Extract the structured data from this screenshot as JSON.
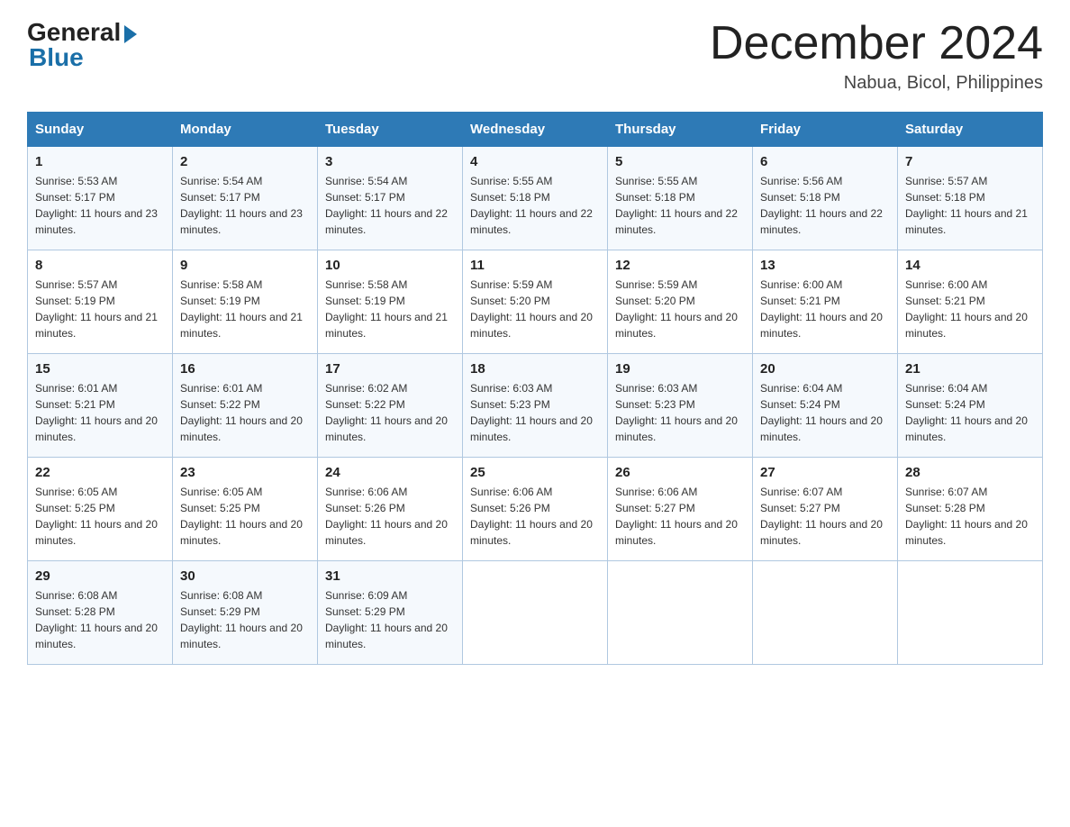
{
  "logo": {
    "general": "General",
    "blue": "Blue"
  },
  "header": {
    "month": "December 2024",
    "location": "Nabua, Bicol, Philippines"
  },
  "days_of_week": [
    "Sunday",
    "Monday",
    "Tuesday",
    "Wednesday",
    "Thursday",
    "Friday",
    "Saturday"
  ],
  "weeks": [
    [
      {
        "day": "1",
        "sunrise": "5:53 AM",
        "sunset": "5:17 PM",
        "daylight": "11 hours and 23 minutes."
      },
      {
        "day": "2",
        "sunrise": "5:54 AM",
        "sunset": "5:17 PM",
        "daylight": "11 hours and 23 minutes."
      },
      {
        "day": "3",
        "sunrise": "5:54 AM",
        "sunset": "5:17 PM",
        "daylight": "11 hours and 22 minutes."
      },
      {
        "day": "4",
        "sunrise": "5:55 AM",
        "sunset": "5:18 PM",
        "daylight": "11 hours and 22 minutes."
      },
      {
        "day": "5",
        "sunrise": "5:55 AM",
        "sunset": "5:18 PM",
        "daylight": "11 hours and 22 minutes."
      },
      {
        "day": "6",
        "sunrise": "5:56 AM",
        "sunset": "5:18 PM",
        "daylight": "11 hours and 22 minutes."
      },
      {
        "day": "7",
        "sunrise": "5:57 AM",
        "sunset": "5:18 PM",
        "daylight": "11 hours and 21 minutes."
      }
    ],
    [
      {
        "day": "8",
        "sunrise": "5:57 AM",
        "sunset": "5:19 PM",
        "daylight": "11 hours and 21 minutes."
      },
      {
        "day": "9",
        "sunrise": "5:58 AM",
        "sunset": "5:19 PM",
        "daylight": "11 hours and 21 minutes."
      },
      {
        "day": "10",
        "sunrise": "5:58 AM",
        "sunset": "5:19 PM",
        "daylight": "11 hours and 21 minutes."
      },
      {
        "day": "11",
        "sunrise": "5:59 AM",
        "sunset": "5:20 PM",
        "daylight": "11 hours and 20 minutes."
      },
      {
        "day": "12",
        "sunrise": "5:59 AM",
        "sunset": "5:20 PM",
        "daylight": "11 hours and 20 minutes."
      },
      {
        "day": "13",
        "sunrise": "6:00 AM",
        "sunset": "5:21 PM",
        "daylight": "11 hours and 20 minutes."
      },
      {
        "day": "14",
        "sunrise": "6:00 AM",
        "sunset": "5:21 PM",
        "daylight": "11 hours and 20 minutes."
      }
    ],
    [
      {
        "day": "15",
        "sunrise": "6:01 AM",
        "sunset": "5:21 PM",
        "daylight": "11 hours and 20 minutes."
      },
      {
        "day": "16",
        "sunrise": "6:01 AM",
        "sunset": "5:22 PM",
        "daylight": "11 hours and 20 minutes."
      },
      {
        "day": "17",
        "sunrise": "6:02 AM",
        "sunset": "5:22 PM",
        "daylight": "11 hours and 20 minutes."
      },
      {
        "day": "18",
        "sunrise": "6:03 AM",
        "sunset": "5:23 PM",
        "daylight": "11 hours and 20 minutes."
      },
      {
        "day": "19",
        "sunrise": "6:03 AM",
        "sunset": "5:23 PM",
        "daylight": "11 hours and 20 minutes."
      },
      {
        "day": "20",
        "sunrise": "6:04 AM",
        "sunset": "5:24 PM",
        "daylight": "11 hours and 20 minutes."
      },
      {
        "day": "21",
        "sunrise": "6:04 AM",
        "sunset": "5:24 PM",
        "daylight": "11 hours and 20 minutes."
      }
    ],
    [
      {
        "day": "22",
        "sunrise": "6:05 AM",
        "sunset": "5:25 PM",
        "daylight": "11 hours and 20 minutes."
      },
      {
        "day": "23",
        "sunrise": "6:05 AM",
        "sunset": "5:25 PM",
        "daylight": "11 hours and 20 minutes."
      },
      {
        "day": "24",
        "sunrise": "6:06 AM",
        "sunset": "5:26 PM",
        "daylight": "11 hours and 20 minutes."
      },
      {
        "day": "25",
        "sunrise": "6:06 AM",
        "sunset": "5:26 PM",
        "daylight": "11 hours and 20 minutes."
      },
      {
        "day": "26",
        "sunrise": "6:06 AM",
        "sunset": "5:27 PM",
        "daylight": "11 hours and 20 minutes."
      },
      {
        "day": "27",
        "sunrise": "6:07 AM",
        "sunset": "5:27 PM",
        "daylight": "11 hours and 20 minutes."
      },
      {
        "day": "28",
        "sunrise": "6:07 AM",
        "sunset": "5:28 PM",
        "daylight": "11 hours and 20 minutes."
      }
    ],
    [
      {
        "day": "29",
        "sunrise": "6:08 AM",
        "sunset": "5:28 PM",
        "daylight": "11 hours and 20 minutes."
      },
      {
        "day": "30",
        "sunrise": "6:08 AM",
        "sunset": "5:29 PM",
        "daylight": "11 hours and 20 minutes."
      },
      {
        "day": "31",
        "sunrise": "6:09 AM",
        "sunset": "5:29 PM",
        "daylight": "11 hours and 20 minutes."
      },
      null,
      null,
      null,
      null
    ]
  ],
  "labels": {
    "sunrise": "Sunrise:",
    "sunset": "Sunset:",
    "daylight": "Daylight:"
  }
}
